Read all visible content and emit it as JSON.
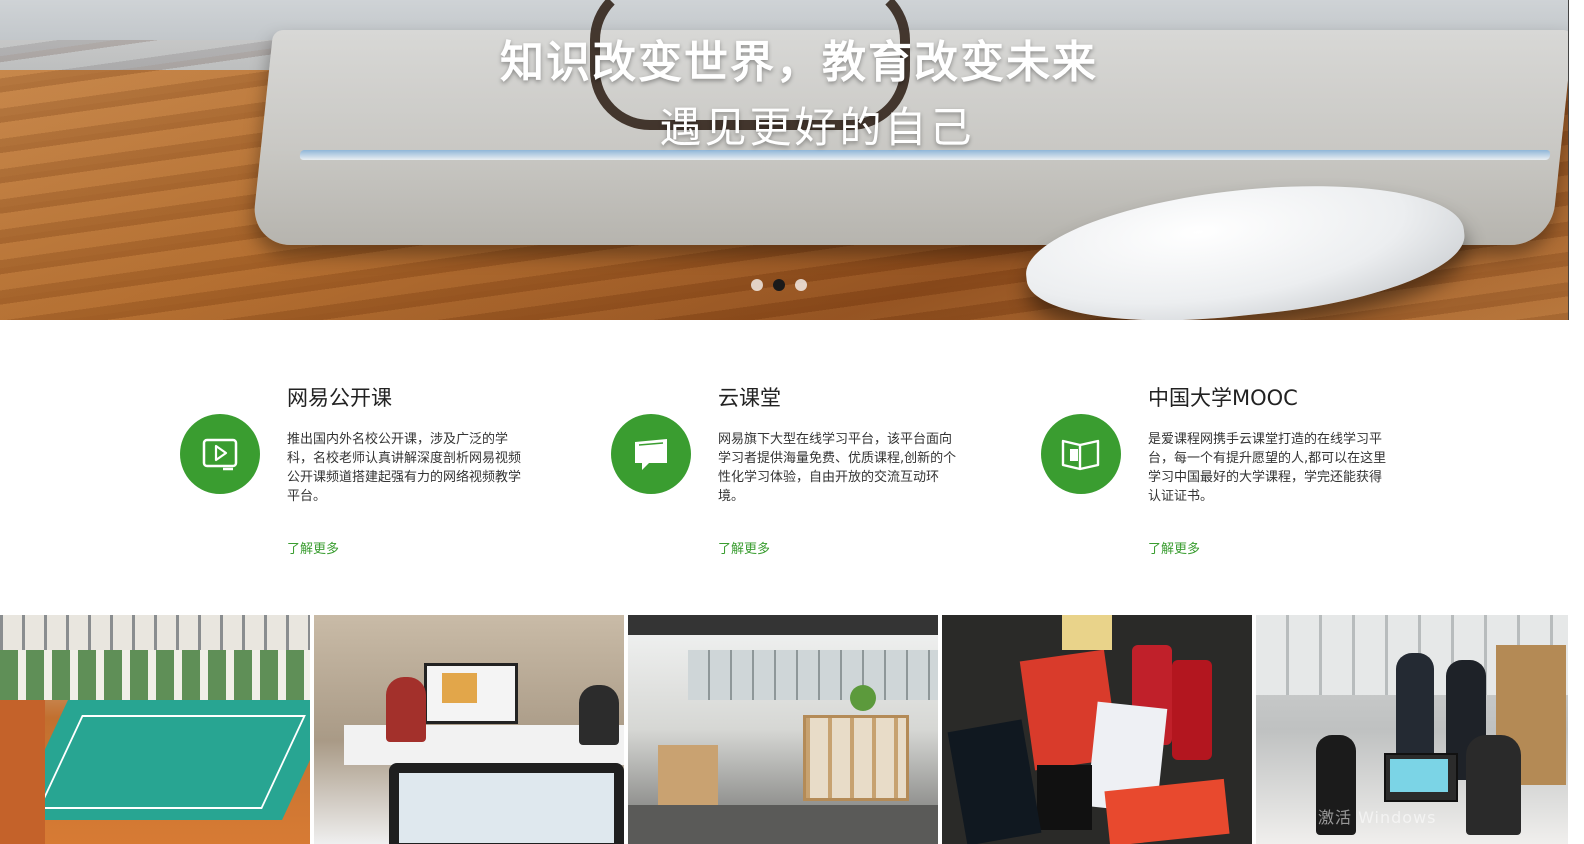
{
  "hero": {
    "headline": "知识改变世界，教育改变未来",
    "subline": "遇见更好的自己",
    "slides_total": 3,
    "active_slide_index": 1
  },
  "features": [
    {
      "title": "网易公开课",
      "description": "推出国内外名校公开课，涉及广泛的学科，名校老师认真讲解深度剖析网易视频公开课频道搭建起强有力的网络视频教学平台。",
      "link": "了解更多",
      "icon": "play-video-icon"
    },
    {
      "title": "云课堂",
      "description": "网易旗下大型在线学习平台，该平台面向学习者提供海量免费、优质课程,创新的个性化学习体验，自由开放的交流互动环境。",
      "link": "了解更多",
      "icon": "open-book-icon"
    },
    {
      "title": "中国大学MOOC",
      "description": "是爱课程网携手云课堂打造的在线学习平台，每一个有提升愿望的人,都可以在这里学习中国最好的大学课程，学完还能获得认证证书。",
      "link": "了解更多",
      "icon": "book-reader-icon"
    }
  ],
  "photos": [
    "sports-hall-photo",
    "meeting-room-photo",
    "office-lobby-photo",
    "snacks-photo",
    "video-shoot-photo"
  ],
  "colors": {
    "accent_green": "#3a9d30",
    "active_dot": "#1a1a1a",
    "text_dark": "#222222"
  }
}
